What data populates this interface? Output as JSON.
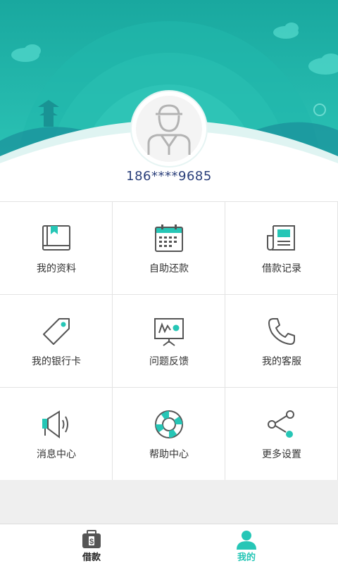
{
  "profile": {
    "phone": "186****9685",
    "avatar_icon": "user-avatar-icon"
  },
  "menu": [
    {
      "label": "我的资料",
      "icon": "profile-book-icon"
    },
    {
      "label": "自助还款",
      "icon": "calendar-icon"
    },
    {
      "label": "借款记录",
      "icon": "newspaper-icon"
    },
    {
      "label": "我的银行卡",
      "icon": "tag-icon"
    },
    {
      "label": "问题反馈",
      "icon": "presentation-board-icon"
    },
    {
      "label": "我的客服",
      "icon": "phone-icon"
    },
    {
      "label": "消息中心",
      "icon": "megaphone-icon"
    },
    {
      "label": "帮助中心",
      "icon": "lifebuoy-icon"
    },
    {
      "label": "更多设置",
      "icon": "share-icon"
    }
  ],
  "tabs": [
    {
      "label": "借款",
      "icon": "wallet-icon",
      "active": false
    },
    {
      "label": "我的",
      "icon": "user-icon",
      "active": true
    }
  ],
  "colors": {
    "accent": "#26c6b6",
    "header_teal": "#1fb5aa",
    "phone_text": "#2a3f7a",
    "active_tab": "#26c6b6",
    "inactive_tab": "#222222"
  }
}
